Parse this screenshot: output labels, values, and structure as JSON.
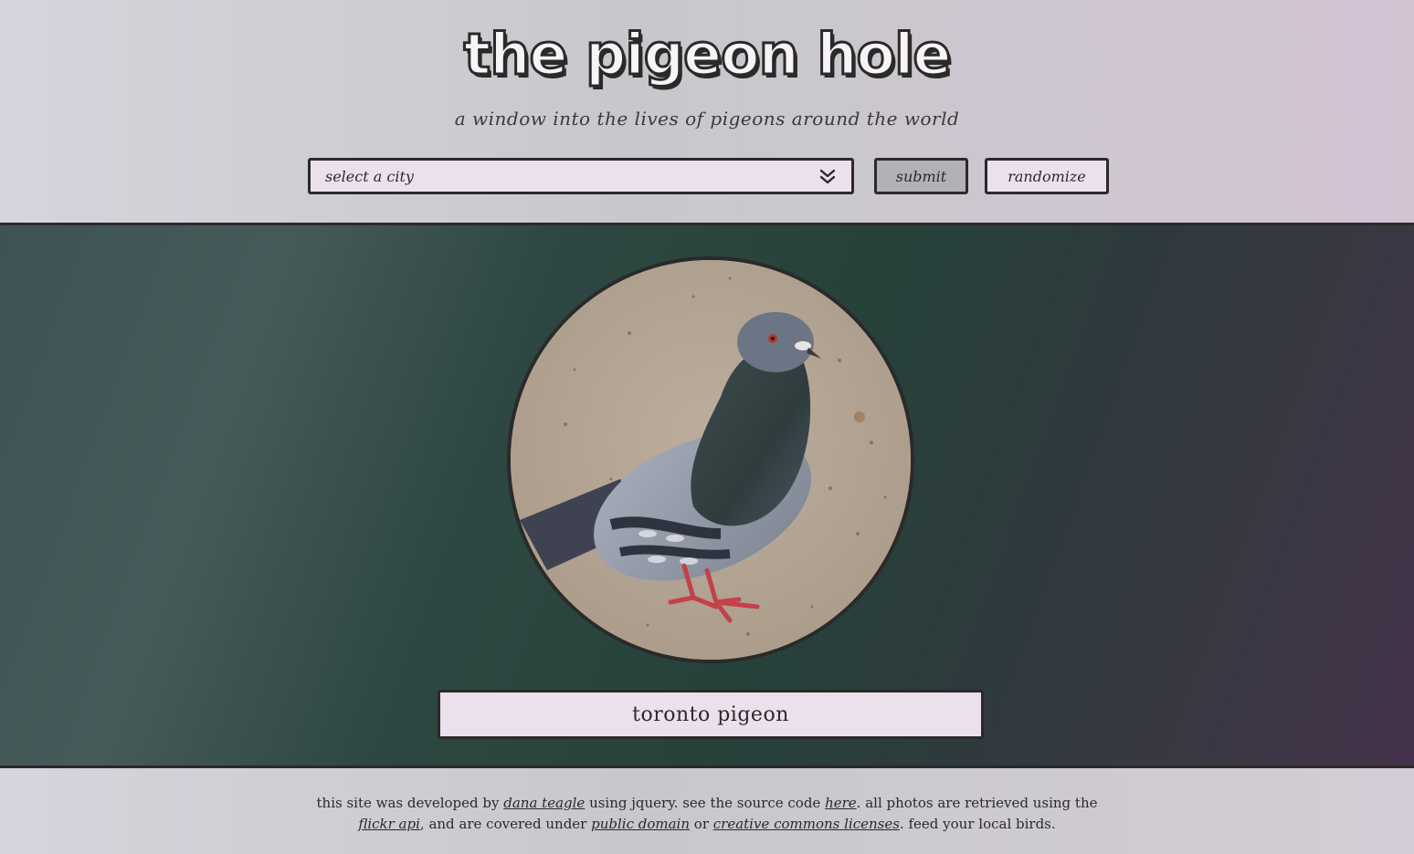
{
  "header": {
    "title": "the pigeon hole",
    "tagline": "a window into the lives of pigeons around the world"
  },
  "controls": {
    "city_select_placeholder": "select a city",
    "submit_label": "submit",
    "randomize_label": "randomize"
  },
  "main": {
    "photo_caption": "toronto pigeon"
  },
  "footer": {
    "text_1": "this site was developed by ",
    "link_author": "dana teagle",
    "text_2": " using jquery. see the source code ",
    "link_source": "here",
    "text_3": ". all photos are retrieved using the ",
    "link_flickr": "flickr api",
    "text_4": ", and are covered under ",
    "link_public_domain": "public domain",
    "text_5": " or ",
    "link_cc": "creative commons licenses",
    "text_6": ". feed your local birds."
  },
  "colors": {
    "border": "#2a2a2a",
    "light_panel": "#ede0ed",
    "submit_bg": "#b4b0b8",
    "main_green": "#26423a"
  },
  "icons": {
    "select_chevron": "double-chevron-down-icon"
  }
}
